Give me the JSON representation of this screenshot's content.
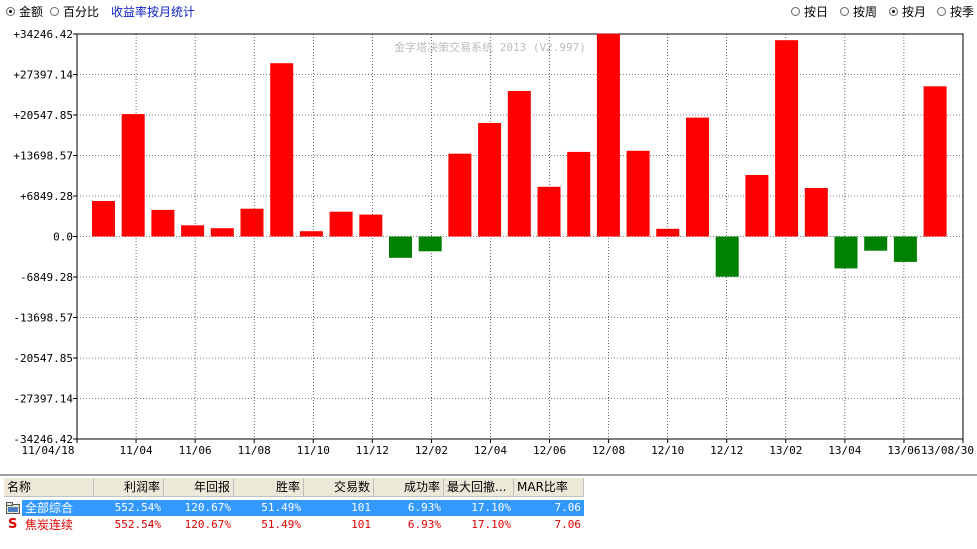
{
  "toolbar": {
    "left_options": [
      {
        "label": "金额",
        "selected": true
      },
      {
        "label": "百分比",
        "selected": false
      }
    ],
    "title_link": "收益率按月统计",
    "period_options": [
      {
        "label": "按日",
        "selected": false
      },
      {
        "label": "按周",
        "selected": false
      },
      {
        "label": "按月",
        "selected": true
      },
      {
        "label": "按季",
        "selected": false
      }
    ]
  },
  "chart_watermark": "金字塔决策交易系统 2013 (V2.997)",
  "colors": {
    "positive": "#ff0000",
    "negative": "#008000",
    "grid": "#000000",
    "selection": "#3399ff"
  },
  "chart_data": {
    "type": "bar",
    "y_ticks": [
      "+34246.42",
      "+27397.14",
      "+20547.85",
      "+13698.57",
      "+6849.28",
      "0.0",
      "-6849.28",
      "-13698.57",
      "-20547.85",
      "-27397.14",
      "-34246.42"
    ],
    "ylim": [
      -34246.42,
      34246.42
    ],
    "x_tick_labels": [
      "11/04/18",
      "11/04",
      "11/06",
      "11/08",
      "11/10",
      "11/12",
      "12/02",
      "12/04",
      "12/06",
      "12/08",
      "12/10",
      "12/12",
      "13/02",
      "13/04",
      "13/06",
      "13/08/30"
    ],
    "categories": [
      "11/04",
      "11/05",
      "11/06",
      "11/07",
      "11/08",
      "11/09",
      "11/10",
      "11/11",
      "11/12",
      "12/01",
      "12/02",
      "12/03",
      "12/04",
      "12/05",
      "12/06",
      "12/07",
      "12/08",
      "12/09",
      "12/10",
      "12/11",
      "12/12",
      "13/01",
      "13/02",
      "13/03",
      "13/04",
      "13/05",
      "13/06",
      "13/07",
      "13/08"
    ],
    "values": [
      6000,
      20700,
      4500,
      1900,
      1400,
      4700,
      29300,
      900,
      4200,
      3700,
      -3600,
      -2500,
      14000,
      19200,
      24600,
      8400,
      14300,
      34300,
      14500,
      1300,
      20100,
      -6800,
      10400,
      33200,
      8200,
      -5400,
      -2400,
      -4300,
      25400
    ],
    "grid": true
  },
  "table": {
    "columns": [
      "名称",
      "利润率",
      "年回报",
      "胜率",
      "交易数",
      "成功率",
      "最大回撤...",
      "MAR比率"
    ],
    "rows": [
      {
        "icon": "folder-icon",
        "name": "全部综合",
        "values": [
          "552.54%",
          "120.67%",
          "51.49%",
          "101",
          "6.93%",
          "17.10%",
          "7.06"
        ],
        "selected": true
      },
      {
        "icon": "S",
        "name": "焦炭连续",
        "values": [
          "552.54%",
          "120.67%",
          "51.49%",
          "101",
          "6.93%",
          "17.10%",
          "7.06"
        ],
        "selected": false
      }
    ]
  }
}
